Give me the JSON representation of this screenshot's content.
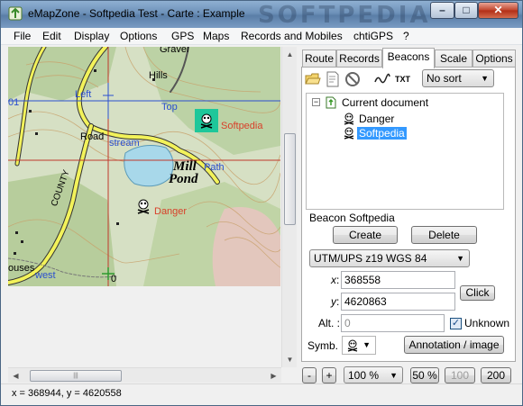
{
  "window": {
    "title": "eMapZone - Softpedia Test - Carte : Example",
    "watermark": "SOFTPEDIA",
    "minimize_symbol": "–",
    "maximize_symbol": "□",
    "close_symbol": "✕"
  },
  "menu": [
    "File",
    "Edit",
    "Display",
    "Options",
    "GPS",
    "Maps",
    "Records and Mobiles",
    "chtiGPS",
    "?"
  ],
  "map": {
    "labels": {
      "gravel": "Gravel",
      "hills": "Hills",
      "left": "Left",
      "top": "Top",
      "road": "Road",
      "stream": "stream",
      "path": "Path",
      "mill": "Mill",
      "pond": "Pond",
      "county": "COUNTY",
      "houses": "ouses",
      "west": "west",
      "zero": "0",
      "one": "01",
      "softpedia": "Softpedia",
      "danger": "Danger"
    },
    "colors": {
      "terrain": "#d6e0c4",
      "forest": "#b9cfa0",
      "road": "#f2f25a",
      "pond": "#a8d8ea",
      "contour": "#c8a06a",
      "beacon_label": "#d8402a",
      "grid_red": "#c0392b",
      "grid_blue": "#2b4fcf",
      "selected_marker": "#1ec79a"
    }
  },
  "scrollbars": {
    "up": "▲",
    "down": "▼",
    "left": "◀",
    "right": "▶",
    "grip": "|||"
  },
  "status": "x = 368944, y = 4620558",
  "tabs": [
    "Route",
    "Records",
    "Beacons",
    "Scale",
    "Options"
  ],
  "active_tab": "Beacons",
  "toolbar": {
    "icons": [
      "open-folder-icon",
      "document-icon",
      "no-entry-icon",
      "squiggle-icon",
      "txt-icon"
    ],
    "txt_label": "TXT",
    "sort": "No sort"
  },
  "tree": {
    "expander": "−",
    "root": "Current document",
    "items": [
      "Danger",
      "Softpedia"
    ],
    "selected": "Softpedia"
  },
  "beacon": {
    "title": "Beacon Softpedia",
    "create": "Create",
    "delete": "Delete",
    "projection": "UTM/UPS z19 WGS 84",
    "x_label": "x",
    "y_label": "y",
    "colon": ":",
    "x": "368558",
    "y": "4620863",
    "click": "Click",
    "alt_label": "Alt. :",
    "alt": "0",
    "unknown_label": "Unknown",
    "unknown_checked": true,
    "check_mark": "✓",
    "symb_label": "Symb. :",
    "annotation_button": "Annotation / image"
  },
  "zoom": {
    "minus": "-",
    "plus": "+",
    "value": "100 %",
    "presets": [
      "50 %",
      "100 %",
      "200 %"
    ]
  },
  "arrow_glyph": "▼"
}
